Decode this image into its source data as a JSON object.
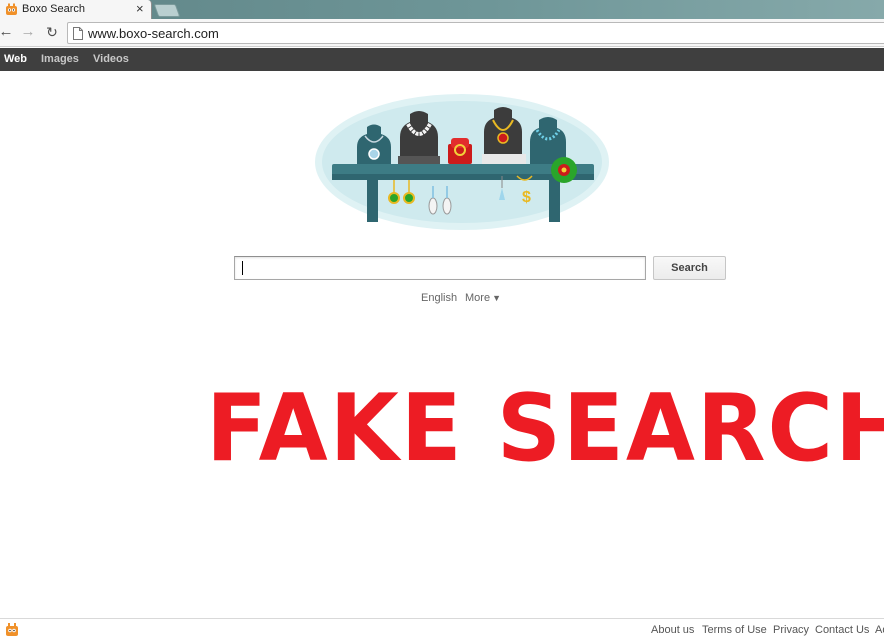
{
  "browser": {
    "tab_title": "Boxo Search",
    "tab_close": "×",
    "url": "www.boxo-search.com",
    "icons": {
      "back": "back-arrow-icon",
      "forward": "forward-arrow-icon",
      "reload": "reload-icon",
      "page": "page-icon",
      "favicon": "boxo-favicon-icon"
    }
  },
  "site_nav": {
    "items": [
      {
        "label": "Web",
        "active": true
      },
      {
        "label": "Images",
        "active": false
      },
      {
        "label": "Videos",
        "active": false
      }
    ]
  },
  "search": {
    "value": "",
    "button_label": "Search"
  },
  "language": {
    "current": "English",
    "more_label": "More",
    "more_arrow": "▼"
  },
  "overlay": {
    "text": "FAKE SEARCH",
    "color": "#ed1c24"
  },
  "footer": {
    "links": [
      "About us",
      "Terms of Use",
      "Privacy",
      "Contact Us",
      "Ad"
    ]
  },
  "colors": {
    "site_nav_bg": "#3f3f3f",
    "logo_accent": "#2f6b73",
    "footer_link": "#555555"
  }
}
